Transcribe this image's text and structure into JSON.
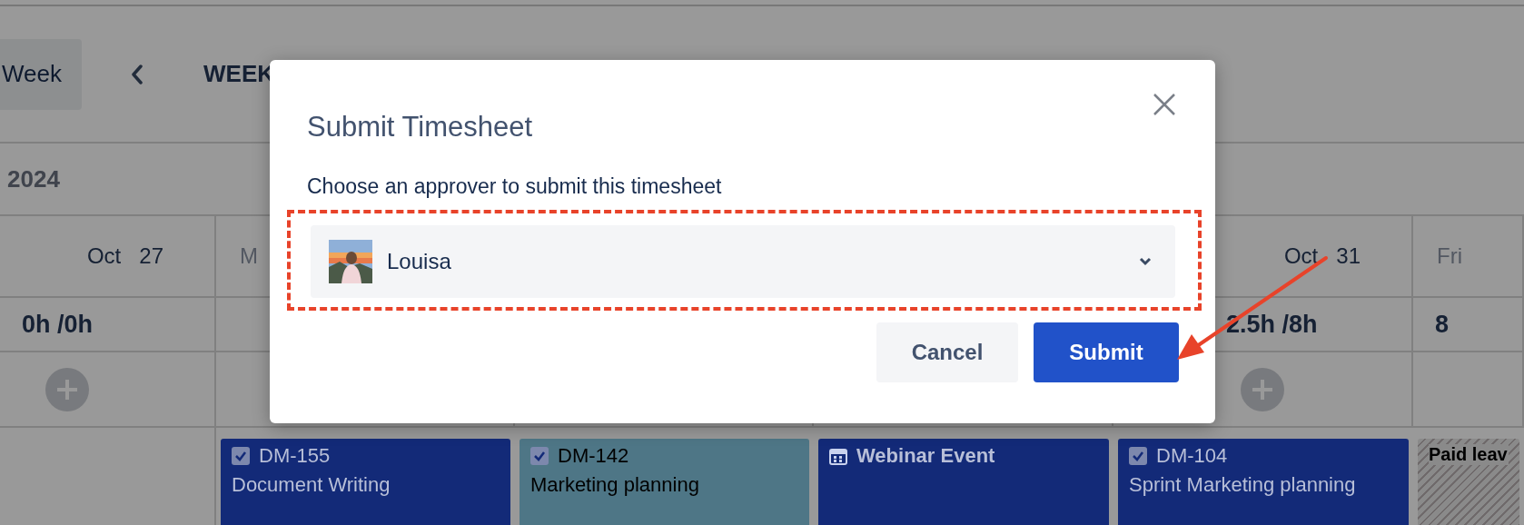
{
  "toolbar": {
    "view_button": "Week",
    "week_label": "WEEK"
  },
  "year_label": "2024",
  "columns": [
    {
      "month": "Oct",
      "day": "27",
      "hours": "0h /0h",
      "add_button": true
    },
    {
      "weekday": "M",
      "add_button": false
    },
    {},
    {},
    {
      "month": "Oct",
      "day": "31",
      "hours": "2.5h /8h",
      "add_button": true
    },
    {
      "weekday": "Fri",
      "hours": "8",
      "add_button": false
    }
  ],
  "cards": [
    {
      "kind": "task",
      "checked": true,
      "key": "DM-155",
      "title": "Document Writing",
      "color": "#132a78"
    },
    {
      "kind": "task",
      "checked": true,
      "key": "DM-142",
      "title": "Marketing planning",
      "color": "#4e7686"
    },
    {
      "kind": "event",
      "title": "Webinar Event",
      "color": "#132a78"
    },
    {
      "kind": "task",
      "checked": true,
      "key": "DM-104",
      "title": "Sprint Marketing planning",
      "color": "#132a78"
    },
    {
      "kind": "leave",
      "title": "Paid leav",
      "color": "#8a8a8a"
    }
  ],
  "dialog": {
    "title": "Submit Timesheet",
    "label": "Choose an approver to submit this timesheet",
    "approver": {
      "name": "Louisa"
    },
    "buttons": [
      {
        "label": "Cancel",
        "kind": "secondary"
      },
      {
        "label": "Submit",
        "kind": "primary"
      }
    ]
  }
}
